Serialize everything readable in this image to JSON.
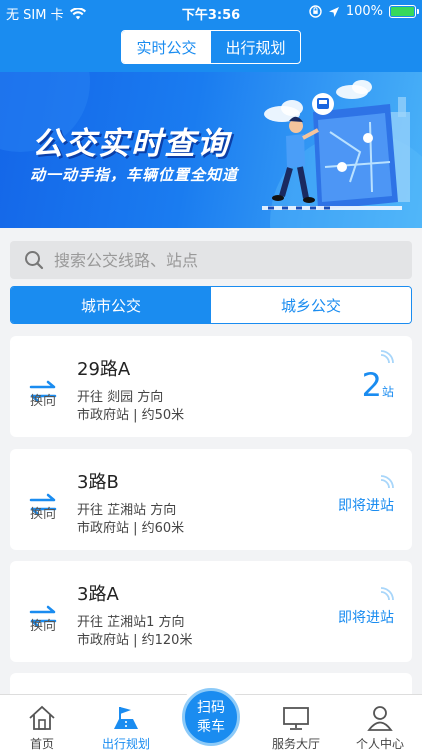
{
  "status": {
    "carrier": "无 SIM 卡",
    "time": "下午3:56",
    "battery": "100%",
    "battery_level": 1.0
  },
  "top_tabs": [
    {
      "label": "实时公交",
      "active": true
    },
    {
      "label": "出行规划",
      "active": false
    }
  ],
  "banner": {
    "title": "公交实时查询",
    "subtitle": "动一动手指，车辆位置全知道"
  },
  "search": {
    "placeholder": "搜索公交线路、站点"
  },
  "category_tabs": [
    {
      "label": "城市公交",
      "active": true
    },
    {
      "label": "城乡公交",
      "active": false
    }
  ],
  "swap_label": "换向",
  "routes": [
    {
      "name": "29路A",
      "direction": "开往 剡园 方向",
      "stop": "市政府站 | 约50米",
      "eta_number": "2",
      "eta_unit": "站",
      "eta_text": ""
    },
    {
      "name": "3路B",
      "direction": "开往 芷湘站 方向",
      "stop": "市政府站 | 约60米",
      "eta_number": "",
      "eta_unit": "",
      "eta_text": "即将进站"
    },
    {
      "name": "3路A",
      "direction": "开往 芷湘站1 方向",
      "stop": "市政府站 | 约120米",
      "eta_number": "",
      "eta_unit": "",
      "eta_text": "即将进站"
    }
  ],
  "tabbar": {
    "home": "首页",
    "travel": "出行规划",
    "scan_line1": "扫码",
    "scan_line2": "乘车",
    "service": "服务大厅",
    "profile": "个人中心"
  },
  "colors": {
    "primary": "#1a8cf0",
    "battery": "#37d85c"
  }
}
